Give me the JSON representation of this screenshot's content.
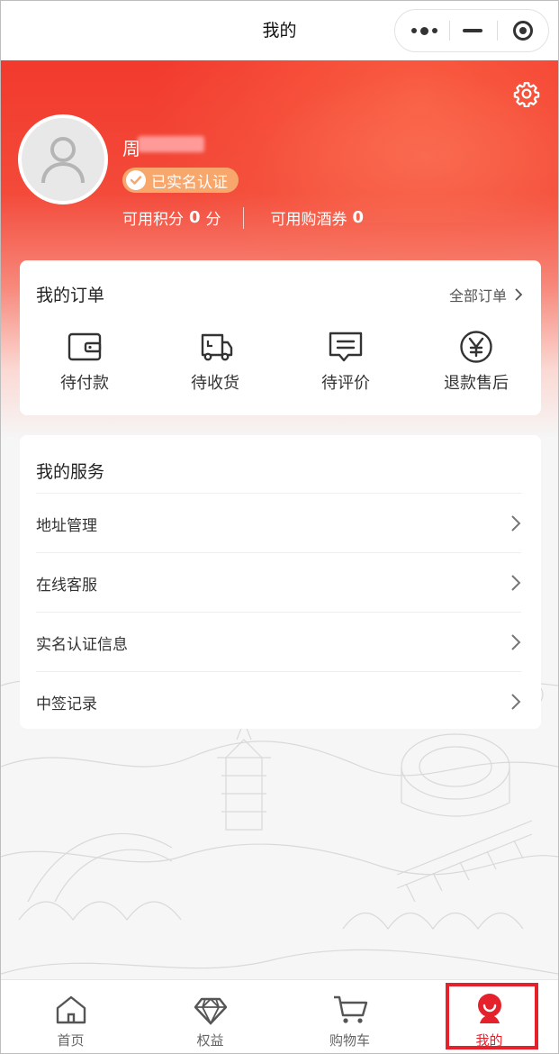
{
  "colors": {
    "accent": "#e5212c",
    "badge": "#f7a66c",
    "hero_top": "#f23a2e"
  },
  "navbar": {
    "title": "我的"
  },
  "profile": {
    "username": "周",
    "verified_label": "已实名认证",
    "points_label": "可用积分",
    "points_value": "0",
    "points_unit": "分",
    "coupons_label": "可用购酒券",
    "coupons_value": "0"
  },
  "orders": {
    "title": "我的订单",
    "all_label": "全部订单",
    "items": [
      {
        "label": "待付款",
        "icon": "wallet-icon"
      },
      {
        "label": "待收货",
        "icon": "truck-icon"
      },
      {
        "label": "待评价",
        "icon": "comment-icon"
      },
      {
        "label": "退款售后",
        "icon": "yuan-icon"
      }
    ]
  },
  "services": {
    "title": "我的服务",
    "items": [
      {
        "label": "地址管理"
      },
      {
        "label": "在线客服"
      },
      {
        "label": "实名认证信息"
      },
      {
        "label": "中签记录"
      }
    ]
  },
  "tabbar": {
    "items": [
      {
        "label": "首页",
        "icon": "home-icon"
      },
      {
        "label": "权益",
        "icon": "diamond-icon"
      },
      {
        "label": "购物车",
        "icon": "cart-icon"
      },
      {
        "label": "我的",
        "icon": "profile-icon",
        "active": true
      }
    ]
  }
}
